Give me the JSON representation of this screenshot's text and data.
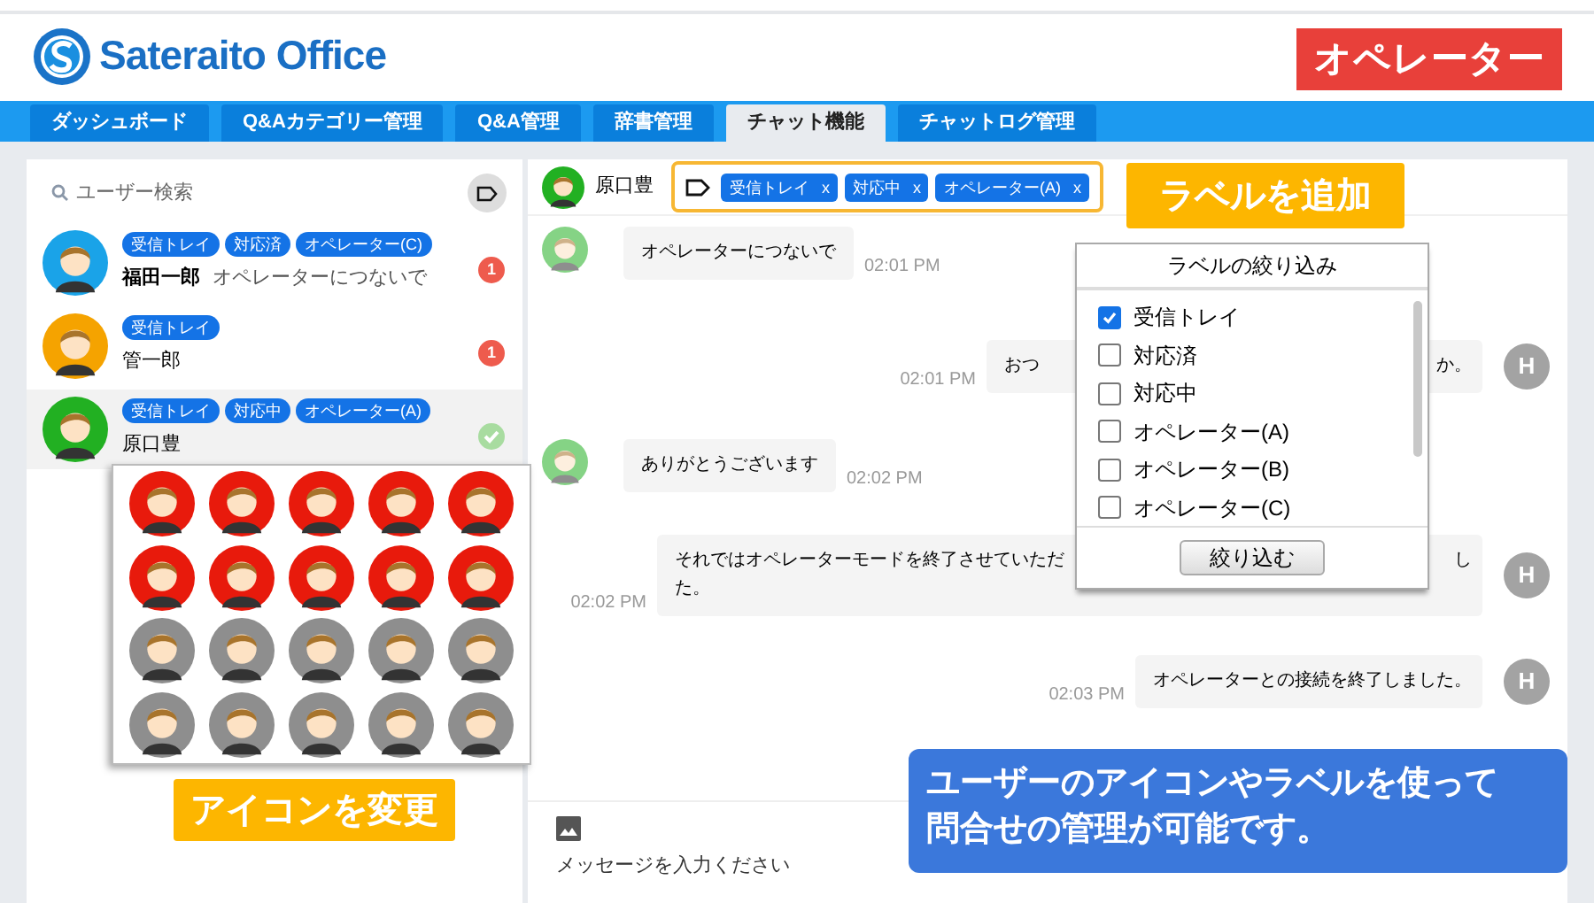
{
  "logo": {
    "text": "Sateraito Office"
  },
  "role_badge": "オペレーター",
  "nav_tabs": [
    {
      "label": "ダッシュボード",
      "selected": false
    },
    {
      "label": "Q&Aカテゴリー管理",
      "selected": false
    },
    {
      "label": "Q&A管理",
      "selected": false
    },
    {
      "label": "辞書管理",
      "selected": false
    },
    {
      "label": "チャット機能",
      "selected": true
    },
    {
      "label": "チャットログ管理",
      "selected": false
    }
  ],
  "user_search": {
    "placeholder": "ユーザー検索"
  },
  "users": [
    {
      "name": "福田一郎",
      "preview": "オペレーターにつないで",
      "labels": [
        "受信トレイ",
        "対応済",
        "オペレーター(C)"
      ],
      "color": "#1aa3e8",
      "selected": false,
      "status": {
        "kind": "unread",
        "text": "1"
      }
    },
    {
      "name": "管一郎",
      "labels": [
        "受信トレイ"
      ],
      "color": "#f5a300",
      "selected": false,
      "status": {
        "kind": "unread",
        "text": "1"
      }
    },
    {
      "name": "原口豊",
      "labels": [
        "受信トレイ",
        "対応中",
        "オペレーター(A)"
      ],
      "color": "#22b022",
      "selected": true,
      "status": {
        "kind": "done"
      }
    }
  ],
  "chat_header": {
    "name": "原口豊",
    "color": "#22b022",
    "labels": [
      {
        "text": "受信トレイ",
        "remove": "x"
      },
      {
        "text": "対応中",
        "remove": "x"
      },
      {
        "text": "オペレーター(A)",
        "remove": "x"
      }
    ]
  },
  "messages": [
    {
      "kind": "incoming",
      "lines": [
        [
          "オペレーターにつないで"
        ]
      ],
      "time": "02:01 PM"
    },
    {
      "kind": "outgoing",
      "lines": [
        [
          "おつ",
          "か。"
        ]
      ],
      "time": "02:01 PM",
      "avatar_letter": "H"
    },
    {
      "kind": "incoming",
      "lines": [
        [
          "ありがとうございます"
        ]
      ],
      "time": "02:02 PM"
    },
    {
      "kind": "outgoing",
      "lines": [
        [
          "それではオペレーターモードを終了させていただ",
          "し"
        ],
        [
          "た。"
        ]
      ],
      "time": "02:02 PM",
      "avatar_letter": "H"
    },
    {
      "kind": "outgoing",
      "lines": [
        [
          "オペレーターとの接続を終了しました。"
        ]
      ],
      "time": "02:03 PM",
      "avatar_letter": "H"
    }
  ],
  "composer": {
    "placeholder": "メッセージを入力ください"
  },
  "label_filter": {
    "title": "ラベルの絞り込み",
    "options": [
      {
        "label": "受信トレイ",
        "checked": true
      },
      {
        "label": "対応済",
        "checked": false
      },
      {
        "label": "対応中",
        "checked": false
      },
      {
        "label": "オペレーター(A)",
        "checked": false
      },
      {
        "label": "オペレーター(B)",
        "checked": false
      },
      {
        "label": "オペレーター(C)",
        "checked": false
      }
    ],
    "apply_button": "絞り込む"
  },
  "icon_picker": [
    {
      "color": "#e81a0c"
    },
    {
      "color": "#e81a0c"
    },
    {
      "color": "#e81a0c"
    },
    {
      "color": "#e81a0c"
    },
    {
      "color": "#e81a0c"
    },
    {
      "color": "#e81a0c"
    },
    {
      "color": "#e81a0c"
    },
    {
      "color": "#e81a0c"
    },
    {
      "color": "#e81a0c"
    },
    {
      "color": "#e81a0c"
    },
    {
      "color": "#8e8e8e"
    },
    {
      "color": "#8e8e8e"
    },
    {
      "color": "#8e8e8e"
    },
    {
      "color": "#8e8e8e"
    },
    {
      "color": "#8e8e8e"
    },
    {
      "color": "#8e8e8e"
    },
    {
      "color": "#8e8e8e"
    },
    {
      "color": "#8e8e8e"
    },
    {
      "color": "#8e8e8e"
    },
    {
      "color": "#8e8e8e"
    }
  ],
  "add_label_callout": "ラベルを追加",
  "change_icon_callout": "アイコンを変更",
  "info_callout": {
    "lines": [
      "ユーザーのアイコンやラベルを使って",
      "問合せの管理が可能です。"
    ]
  }
}
